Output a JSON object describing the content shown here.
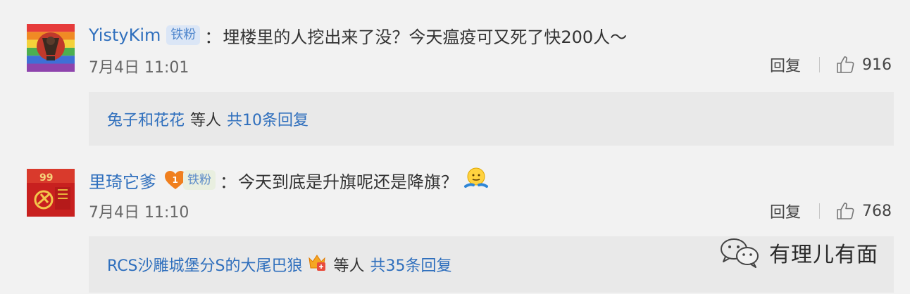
{
  "comments": [
    {
      "username": "YistyKim",
      "badge": "铁粉",
      "separator": "：",
      "text": "埋楼里的人挖出来了没？今天瘟疫可又死了快200人～",
      "time": "7月4日 11:01",
      "reply_label": "回复",
      "like_count": "916",
      "replies": {
        "user": "兔子和花花",
        "etc": "等人",
        "total": "共10条回复"
      }
    },
    {
      "username": "里琦它爹",
      "badge_level": "1",
      "badge": "铁粉",
      "separator": "：",
      "text": "今天到底是升旗呢还是降旗？",
      "time": "7月4日 11:10",
      "reply_label": "回复",
      "like_count": "768",
      "replies": {
        "user": "RCS沙雕城堡分S的大尾巴狼",
        "etc": "等人",
        "total": "共35条回复"
      }
    }
  ],
  "watermark": {
    "text": "有理儿有面"
  },
  "colors": {
    "link": "#2f6fbd",
    "text": "#333333",
    "meta": "#666666",
    "background": "#f2f2f2",
    "reply_box": "#e9e9e9"
  },
  "icons": {
    "like": "thumbs-up-icon",
    "emoji": "shrug-emoji-icon",
    "crown": "crown-badge-icon",
    "watermark": "wechat-logo-icon"
  }
}
